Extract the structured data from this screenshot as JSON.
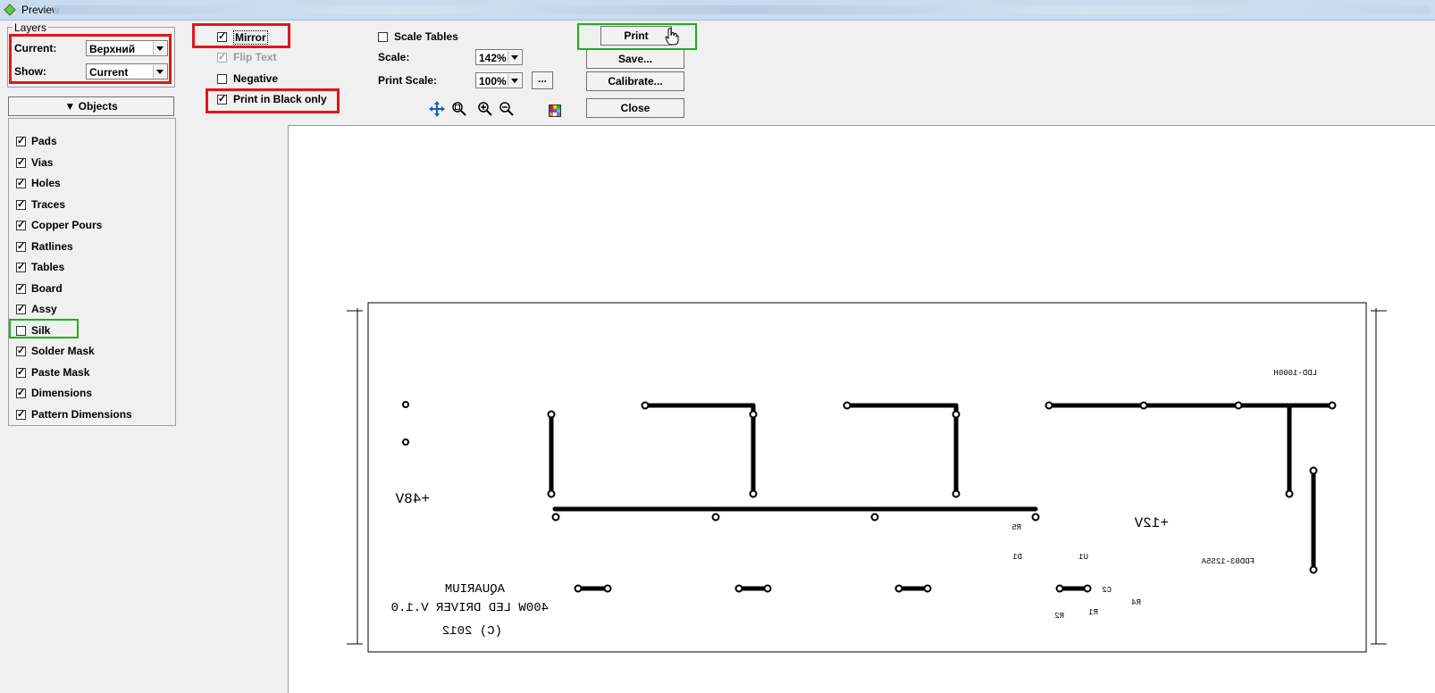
{
  "window": {
    "title": "Preview"
  },
  "layers": {
    "group_label": "Layers",
    "current_label": "Current:",
    "current_value": "Верхний",
    "show_label": "Show:",
    "show_value": "Current"
  },
  "objects": {
    "button_label": "Objects",
    "items": [
      {
        "label": "Pads",
        "checked": true
      },
      {
        "label": "Vias",
        "checked": true
      },
      {
        "label": "Holes",
        "checked": true
      },
      {
        "label": "Traces",
        "checked": true
      },
      {
        "label": "Copper Pours",
        "checked": true
      },
      {
        "label": "Ratlines",
        "checked": true
      },
      {
        "label": "Tables",
        "checked": true
      },
      {
        "label": "Board",
        "checked": true
      },
      {
        "label": "Assy",
        "checked": true
      },
      {
        "label": "Silk",
        "checked": false
      },
      {
        "label": "Solder Mask",
        "checked": true
      },
      {
        "label": "Paste Mask",
        "checked": true
      },
      {
        "label": "Dimensions",
        "checked": true
      },
      {
        "label": "Pattern Dimensions",
        "checked": true
      }
    ]
  },
  "options": {
    "mirror": {
      "label": "Mirror",
      "checked": true
    },
    "flip_text": {
      "label": "Flip Text",
      "checked": true,
      "disabled": true
    },
    "negative": {
      "label": "Negative",
      "checked": false
    },
    "black_only": {
      "label": "Print in Black only",
      "checked": true
    },
    "scale_tables": {
      "label": "Scale Tables",
      "checked": false
    }
  },
  "scale": {
    "scale_label": "Scale:",
    "scale_value": "142%",
    "print_scale_label": "Print Scale:",
    "print_scale_value": "100%",
    "ellipsis": "..."
  },
  "buttons": {
    "print": "Print",
    "save": "Save...",
    "calibrate": "Calibrate...",
    "close": "Close"
  },
  "toolbar_icons": [
    "move-icon",
    "zoom-fit-icon",
    "zoom-in-icon",
    "zoom-out-icon",
    "color-palette-icon"
  ],
  "pcb": {
    "label_48v": "+48V",
    "label_12v": "+12V",
    "part_ldd": "LDD-1000H",
    "part_fdd": "FDD03-12S5A",
    "ref_r5": "R5",
    "ref_d1": "D1",
    "ref_u1": "U1",
    "ref_c2": "C2",
    "ref_r4": "R4",
    "ref_r1": "R1",
    "ref_r2": "R2",
    "title_1": "AQUARIUM",
    "title_2": "400W LED DRIVER V.1.0",
    "title_3": "(C) 2012"
  },
  "colors": {
    "highlight_red": "#e0161b",
    "highlight_green": "#19b219",
    "titlebar": "#c9dcef"
  }
}
